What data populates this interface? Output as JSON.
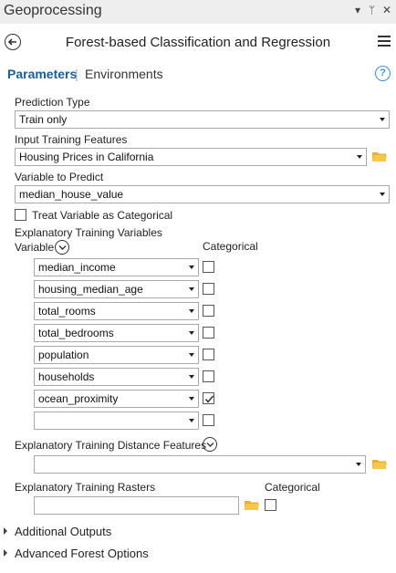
{
  "window": {
    "title": "Geoprocessing",
    "pin_glyph": "▾",
    "autohide_glyph": "ᛘ",
    "close_glyph": "✕"
  },
  "tool": {
    "title": "Forest-based Classification and Regression"
  },
  "tabs": {
    "parameters": "Parameters",
    "separator": "|",
    "environments": "Environments",
    "help_glyph": "?"
  },
  "params": {
    "prediction_type": {
      "label": "Prediction Type",
      "value": "Train only"
    },
    "input_training_features": {
      "label": "Input Training Features",
      "value": "Housing Prices in California"
    },
    "variable_to_predict": {
      "label": "Variable to Predict",
      "value": "median_house_value"
    },
    "treat_categorical": {
      "label": "Treat Variable as Categorical",
      "checked": false
    },
    "explanatory_vars": {
      "label": "Explanatory Training Variables",
      "col_variable": "Variable",
      "col_categorical": "Categorical",
      "rows": [
        {
          "name": "median_income",
          "categorical": false
        },
        {
          "name": "housing_median_age",
          "categorical": false
        },
        {
          "name": "total_rooms",
          "categorical": false
        },
        {
          "name": "total_bedrooms",
          "categorical": false
        },
        {
          "name": "population",
          "categorical": false
        },
        {
          "name": "households",
          "categorical": false
        },
        {
          "name": "ocean_proximity",
          "categorical": true
        },
        {
          "name": "",
          "categorical": false
        }
      ]
    },
    "distance_features": {
      "label": "Explanatory Training Distance Features",
      "value": ""
    },
    "rasters": {
      "label": "Explanatory Training Rasters",
      "col_categorical": "Categorical",
      "value": ""
    }
  },
  "sections": {
    "additional_outputs": "Additional Outputs",
    "advanced_forest": "Advanced Forest Options"
  },
  "colors": {
    "accent": "#1a5e99",
    "help": "#3e8fd6",
    "folder": "#e8b030"
  }
}
